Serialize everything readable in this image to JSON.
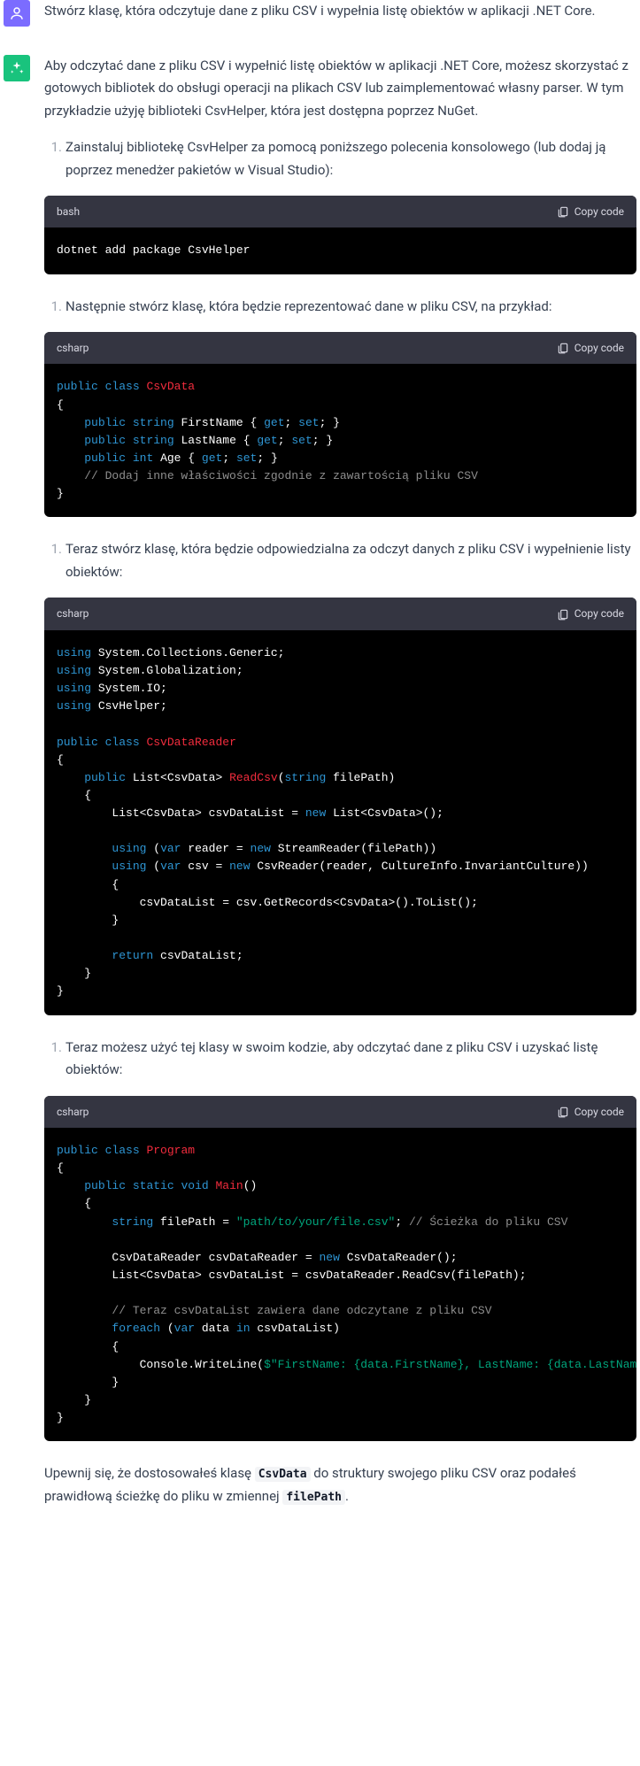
{
  "user_message": "Stwórz klasę, która odczytuje dane z pliku CSV i wypełnia listę obiektów w aplikacji .NET Core.",
  "assistant_intro": "Aby odczytać dane z pliku CSV i wypełnić listę obiektów w aplikacji .NET Core, możesz skorzystać z gotowych bibliotek do obsługi operacji na plikach CSV lub zaimplementować własny parser. W tym przykładzie użyję biblioteki CsvHelper, która jest dostępna poprzez NuGet.",
  "copy_label": "Copy code",
  "steps": [
    {
      "num": "1.",
      "text": "Zainstaluj bibliotekę CsvHelper za pomocą poniższego polecenia konsolowego (lub dodaj ją poprzez menedżer pakietów w Visual Studio):",
      "lang": "bash",
      "code_plain": "dotnet add package CsvHelper"
    },
    {
      "num": "1.",
      "text": "Następnie stwórz klasę, która będzie reprezentować dane w pliku CSV, na przykład:",
      "lang": "csharp"
    },
    {
      "num": "1.",
      "text": "Teraz stwórz klasę, która będzie odpowiedzialna za odczyt danych z pliku CSV i wypełnienie listy obiektów:",
      "lang": "csharp"
    },
    {
      "num": "1.",
      "text": "Teraz możesz użyć tej klasy w swoim kodzie, aby odczytać dane z pliku CSV i uzyskać listę obiektów:",
      "lang": "csharp"
    }
  ],
  "outro_prefix": "Upewnij się, że dostosowałeś klasę ",
  "outro_code1": "CsvData",
  "outro_mid": " do struktury swojego pliku CSV oraz podałeś prawidłową ścieżkę do pliku w zmiennej ",
  "outro_code2": "filePath",
  "outro_suffix": "."
}
